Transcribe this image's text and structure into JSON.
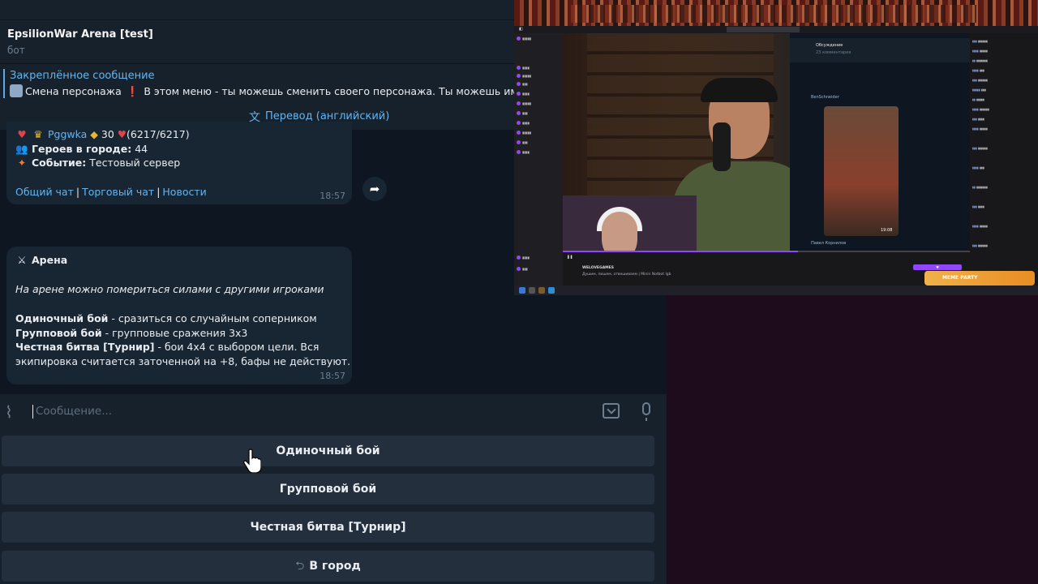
{
  "chat": {
    "title": "EpsilionWar Arena [test]",
    "subtitle": "бот"
  },
  "pinned": {
    "title": "Закреплённое сообщение",
    "text_name": "Смена персонажа",
    "text_desc": "В этом меню - ты можешь сменить своего персонажа. Ты можешь иметь"
  },
  "translate": {
    "label": "Перевод (английский)"
  },
  "message1": {
    "player_name": "Pggwka",
    "player_level": "30",
    "player_hp": "(6217/6217)",
    "heroes_label": "Героев в городе:",
    "heroes_value": "44",
    "event_label": "Событие:",
    "event_value": "Тестовый сервер",
    "links": [
      "Общий чат",
      "Торговый чат",
      "Новости"
    ],
    "time": "18:57"
  },
  "message2": {
    "title": "Арена",
    "intro": "На арене можно помериться силами с другими игроками",
    "single_label": "Одиночный бой",
    "single_desc": " - сразиться со случайным соперником",
    "group_label": "Групповой бой",
    "group_desc": " - групповые сражения 3х3",
    "fair_label": "Честная битва [Турнир]",
    "fair_desc": " - бои 4х4 с выбором цели. Вся",
    "fair_desc2": "экипировка считается заточенной на +8, бафы не действуют.",
    "time": "18:57"
  },
  "composer": {
    "placeholder": "Сообщение..."
  },
  "keyboard": {
    "buttons": [
      "Одиночный бой",
      "Групповой бой",
      "Честная битва [Турнир]",
      "В город"
    ]
  },
  "stream": {
    "channel": "WELOVEGAMES",
    "stream_title": "Душим, пишем, отвешиваем | Minin Notbot lgb",
    "video_time": "19:08",
    "phone_header": "Обсуждение",
    "phone_sub": "23 комментария",
    "phone_user": "BenSchneider",
    "phone_name": "Павел Корнилов",
    "badge": "MEME PARTY"
  },
  "colors": {
    "tg_bg": "#0e1621",
    "tg_panel": "#17212b",
    "bubble": "#182533",
    "link": "#64b5ef",
    "kb_button": "#232f3d",
    "stream_bg": "#1e0b1c"
  }
}
